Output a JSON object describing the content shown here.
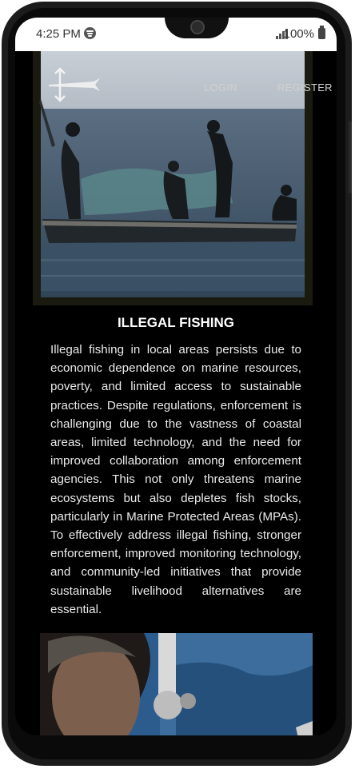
{
  "status_bar": {
    "time": "4:25 PM",
    "battery": "100%"
  },
  "nav": {
    "login": "LOGIN",
    "register": "REGISTER"
  },
  "article": {
    "title": "ILLEGAL FISHING",
    "body": "Illegal fishing in local areas persists due to economic dependence on marine resources, poverty, and limited access to sustainable practices. Despite regulations, enforcement is challenging due to the vastness of coastal areas, limited technology, and the need for improved collaboration among enforcement agencies. This not only threatens marine ecosystems but also depletes fish stocks, particularly in Marine Protected Areas (MPAs). To effectively address illegal fishing, stronger enforcement, improved monitoring technology, and community-led initiatives that provide sustainable livelihood alternatives are essential."
  },
  "icons": {
    "logo": "trident-fish-logo-icon",
    "spotify": "spotify-icon",
    "signal": "signal-icon",
    "battery": "battery-icon"
  }
}
